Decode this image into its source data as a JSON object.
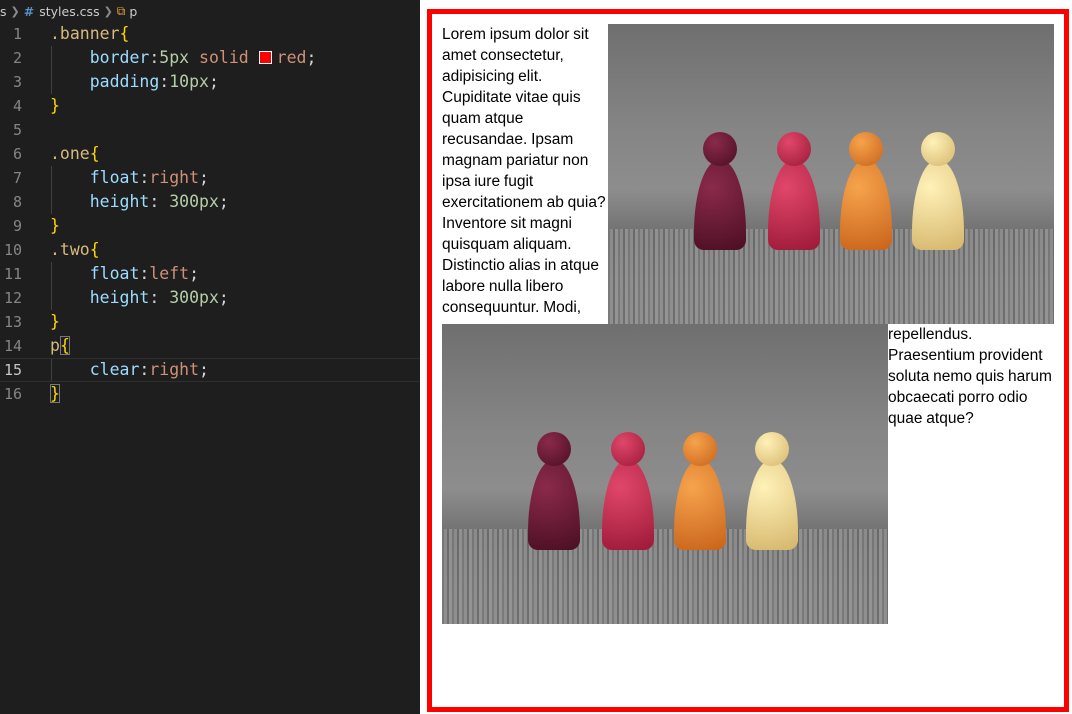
{
  "breadcrumb": {
    "folder_fragment": "s",
    "file": "styles.css",
    "symbol": "p"
  },
  "code_lines": [
    {
      "n": "1"
    },
    {
      "n": "2"
    },
    {
      "n": "3"
    },
    {
      "n": "4"
    },
    {
      "n": "5"
    },
    {
      "n": "6"
    },
    {
      "n": "7"
    },
    {
      "n": "8"
    },
    {
      "n": "9"
    },
    {
      "n": "10"
    },
    {
      "n": "11"
    },
    {
      "n": "12"
    },
    {
      "n": "13"
    },
    {
      "n": "14"
    },
    {
      "n": "15"
    },
    {
      "n": "16"
    }
  ],
  "code": {
    "banner_selector": ".banner",
    "border_prop": "border",
    "border_value": "5px solid ",
    "border_color": "red",
    "padding_prop": "padding",
    "padding_value": "10px",
    "one_selector": ".one",
    "float_prop": "float",
    "float_right": "right",
    "height_prop": "height",
    "height_value": "300px",
    "two_selector": ".two",
    "float_left": "left",
    "p_selector": "p",
    "clear_prop": "clear",
    "clear_value": "right",
    "swatch_color": "#ff0000"
  },
  "preview": {
    "border_color": "#ff0000",
    "image_subject": "four wooden game pawns in a row",
    "paragraph": "Lorem ipsum dolor sit amet consectetur, adipisicing elit. Cupiditate vitae quis quam atque recusandae. Ipsam magnam pariatur non ipsa iure fugit exercitationem ab quia? Inventore sit magni quisquam aliquam. Distinctio alias in atque labore nulla libero consequuntur. Modi, repellendus. Praesentium provident soluta nemo quis harum obcaecati porro odio quae atque?"
  }
}
